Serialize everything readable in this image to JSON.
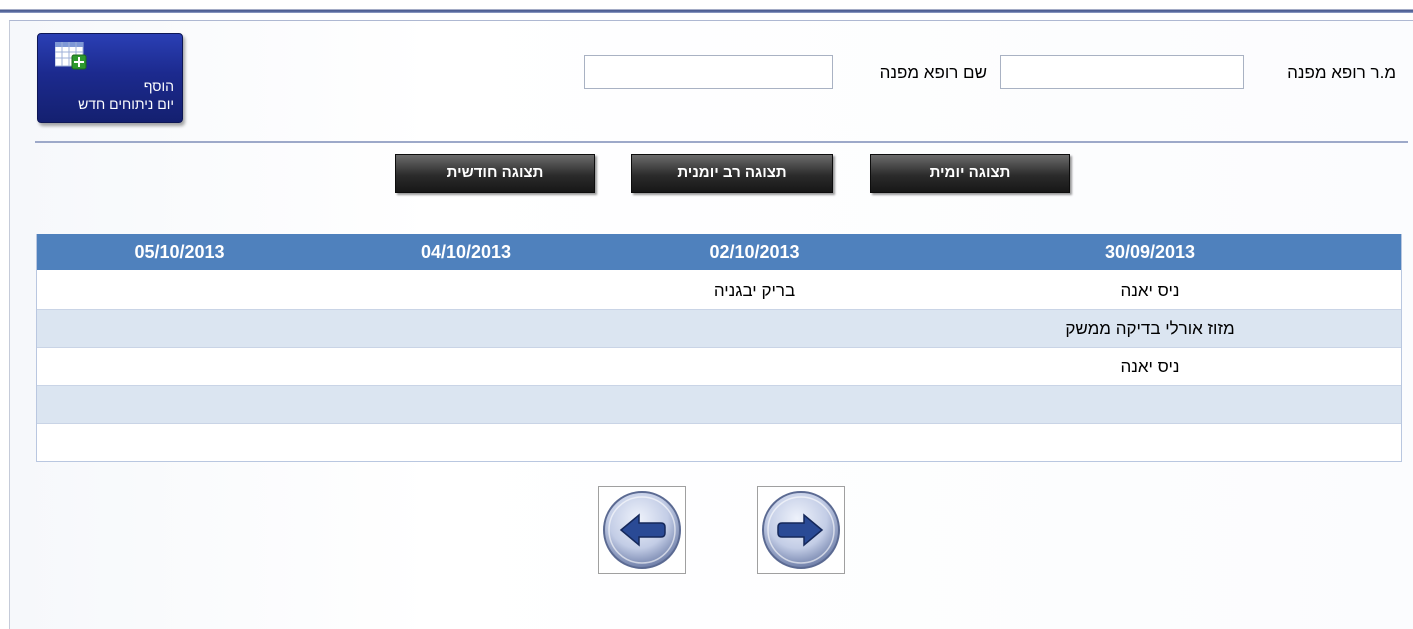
{
  "header": {
    "referrer_id_label": "מ.ר רופא מפנה",
    "referrer_id_value": "",
    "referrer_name_label": "שם רופא מפנה",
    "referrer_name_value": ""
  },
  "add_button": {
    "line1": "הוסף",
    "line2": "יום ניתוחים חדש"
  },
  "views": {
    "daily": "תצוגה יומית",
    "multi_day": "תצוגה רב יומנית",
    "monthly": "תצוגה חודשית"
  },
  "table": {
    "columns": [
      "30/09/2013",
      "02/10/2013",
      "04/10/2013",
      "05/10/2013"
    ],
    "rows": [
      [
        "ניס יאנה",
        "בריק יבגניה",
        "",
        ""
      ],
      [
        "מזוז אורלי בדיקה ממשק",
        "",
        "",
        ""
      ],
      [
        "ניס יאנה",
        "",
        "",
        ""
      ],
      [
        "",
        "",
        "",
        ""
      ],
      [
        "",
        "",
        "",
        ""
      ]
    ]
  },
  "pager": {
    "prev_icon": "arrow-left-icon",
    "next_icon": "arrow-right-icon"
  },
  "colors": {
    "table_header": "#4f81bd",
    "alt_row": "#dbe5f1",
    "button_blue": "#1c2a8e"
  }
}
